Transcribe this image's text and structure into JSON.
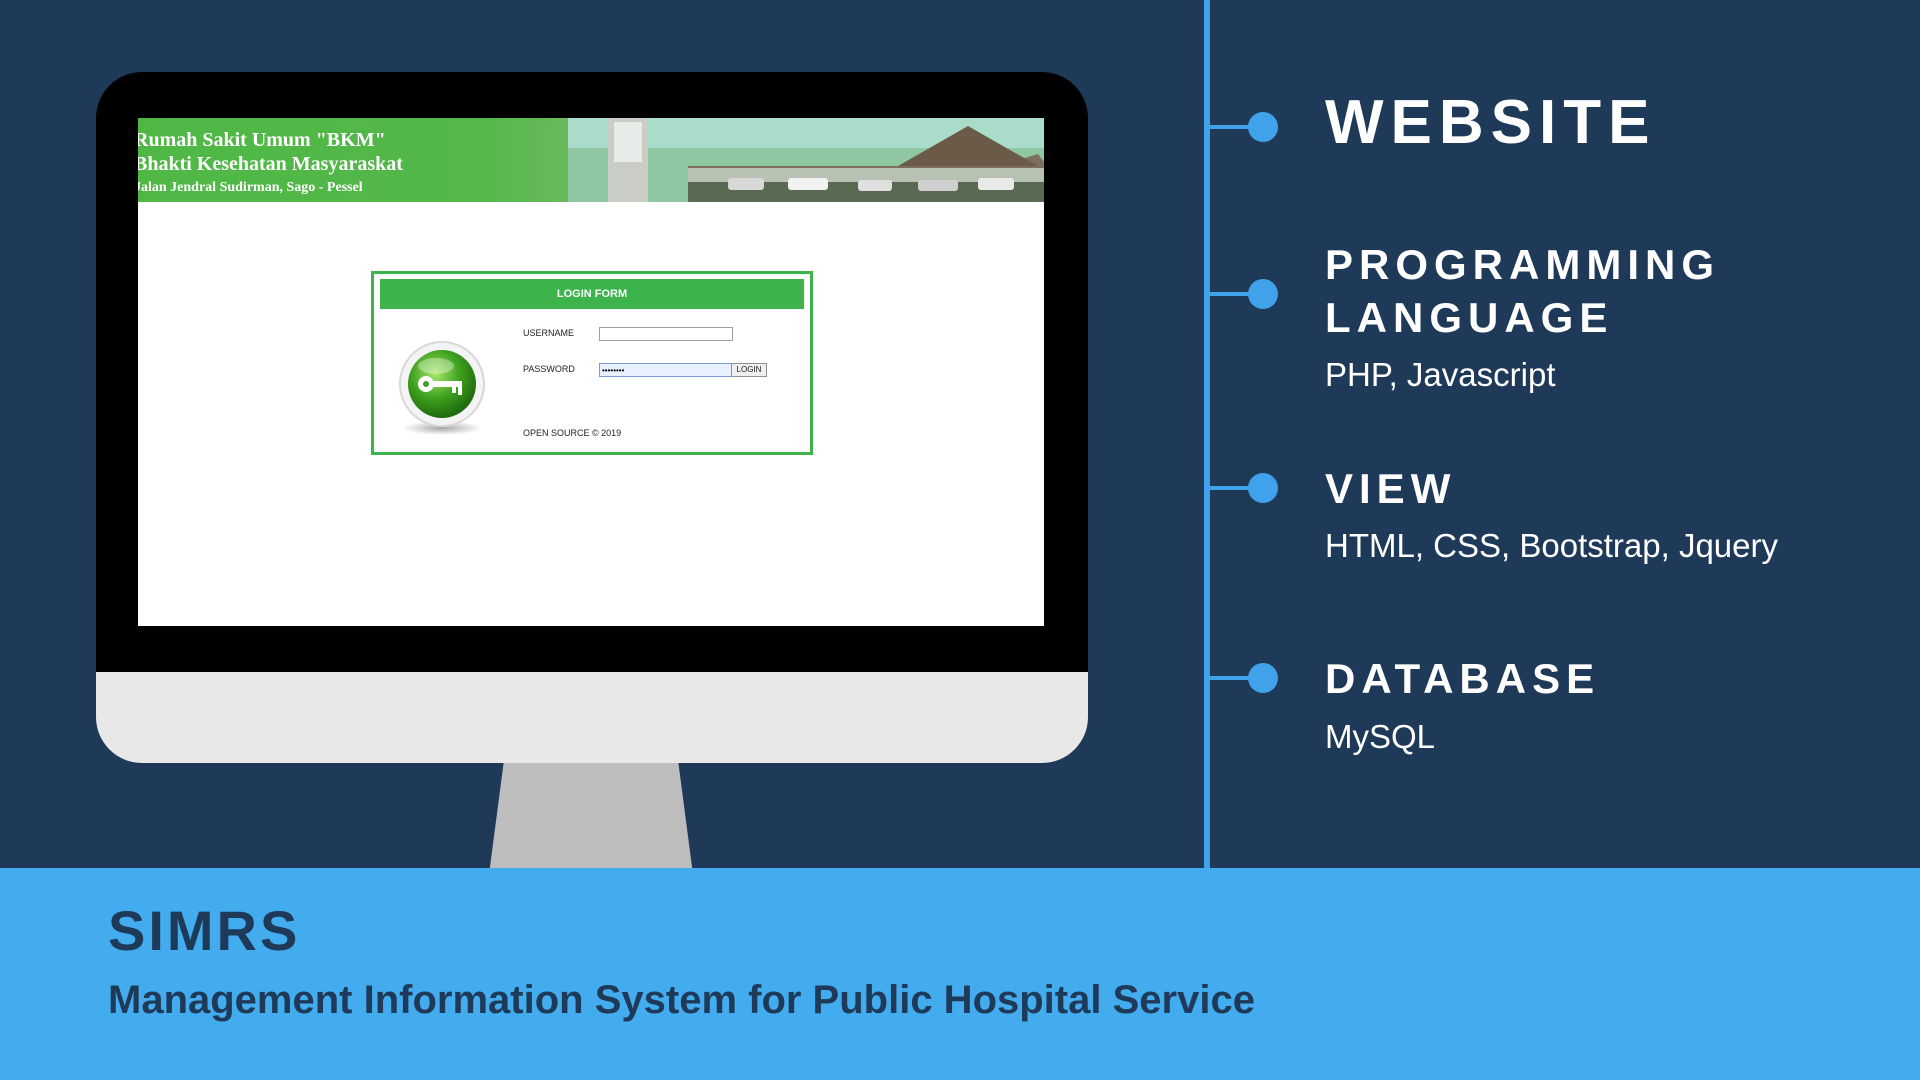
{
  "monitor": {
    "site_header": {
      "line1": "Rumah Sakit Umum \"BKM\"",
      "line2": "Bhakti Kesehatan Masyaraskat",
      "line3": "Jalan Jendral Sudirman, Sago - Pessel"
    },
    "login_form": {
      "title": "LOGIN FORM",
      "username_label": "USERNAME",
      "username_value": "",
      "password_label": "PASSWORD",
      "password_value": "••••••••",
      "login_button": "LOGIN",
      "footer": "OPEN SOURCE © 2019"
    }
  },
  "tech_panel": {
    "items": [
      {
        "heading": "WEBSITE",
        "sub": ""
      },
      {
        "heading": "PROGRAMMING",
        "heading2": "LANGUAGE",
        "sub": "PHP, Javascript"
      },
      {
        "heading": "VIEW",
        "sub": "HTML, CSS, Bootstrap, Jquery"
      },
      {
        "heading": "DATABASE",
        "sub": "MySQL"
      }
    ]
  },
  "banner": {
    "title": "SIMRS",
    "subtitle": "Management Information System for Public Hospital Service"
  },
  "colors": {
    "background": "#1e3a58",
    "accent": "#3fa2eb",
    "banner": "#42acef",
    "login_green": "#3cb44b"
  }
}
